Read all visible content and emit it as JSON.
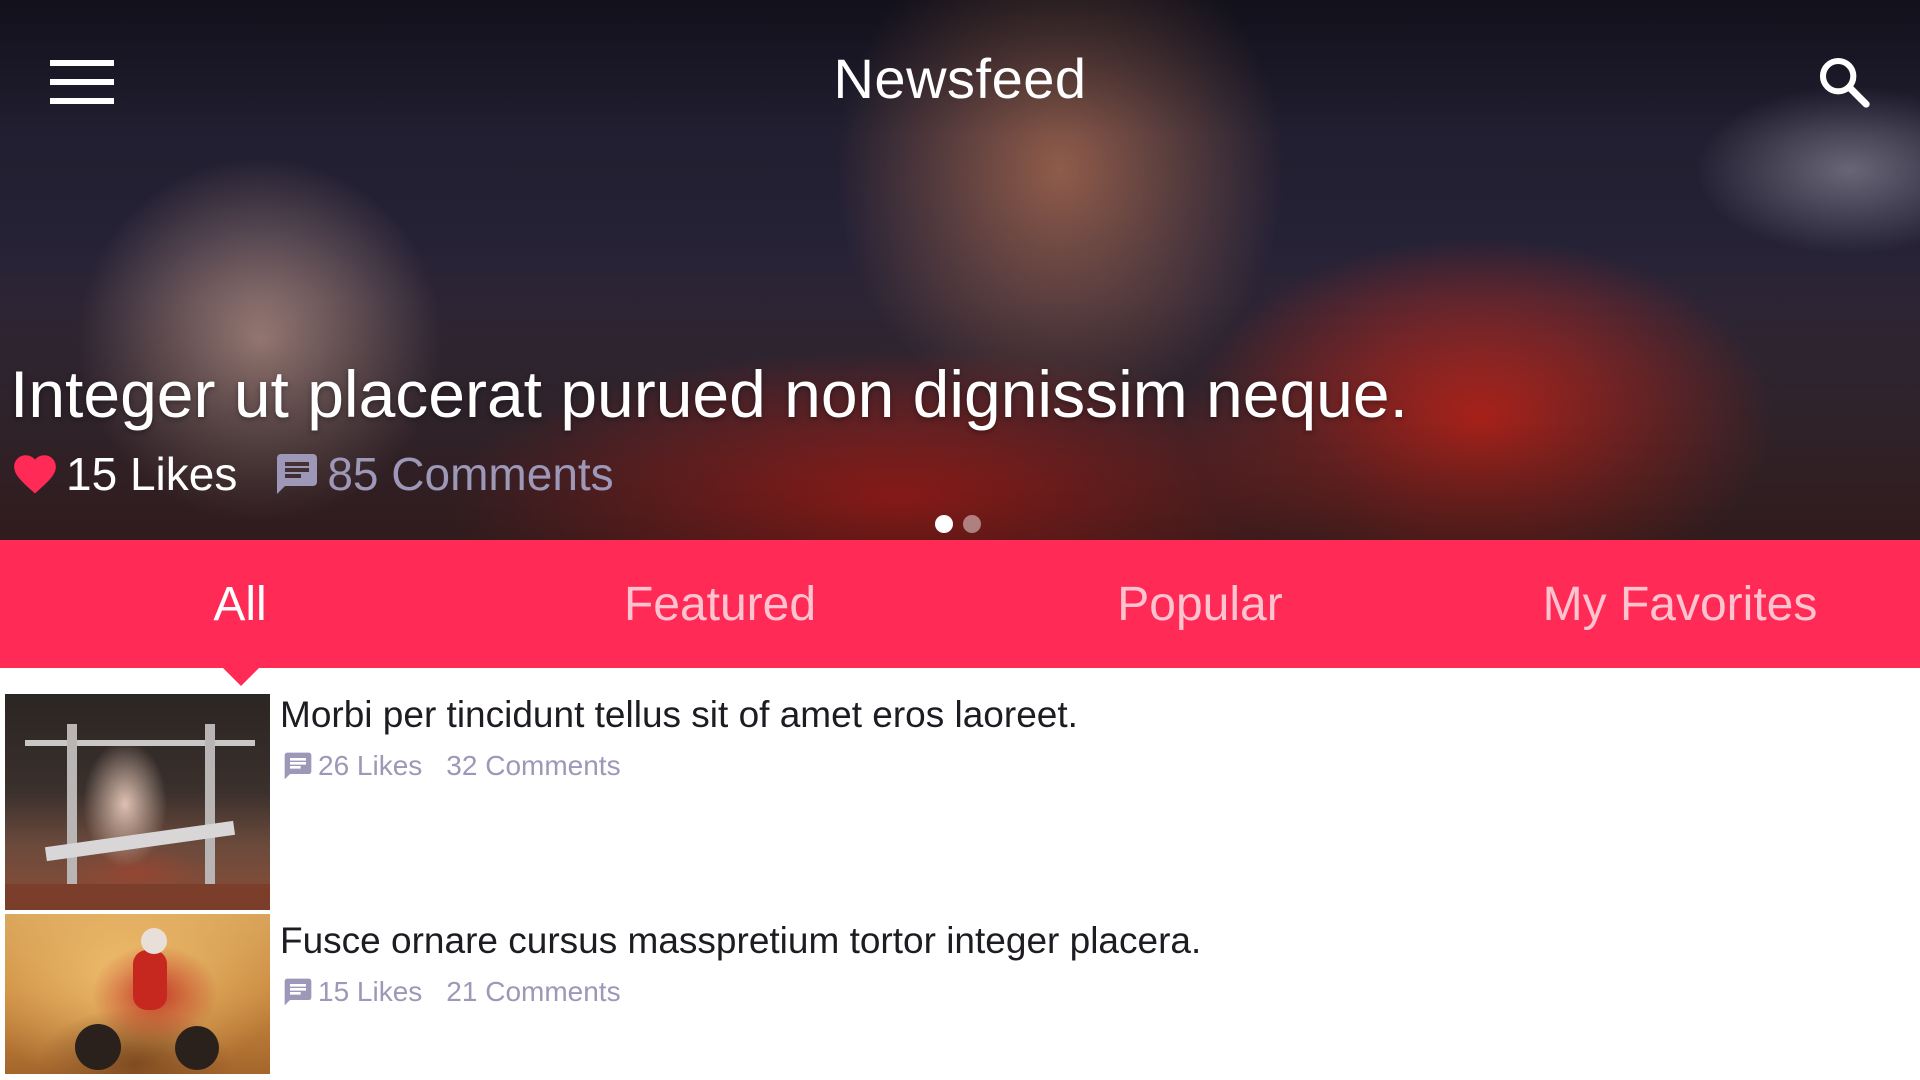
{
  "header": {
    "title": "Newsfeed",
    "menu_icon": "menu-icon",
    "search_icon": "search-icon"
  },
  "hero": {
    "headline": "Integer ut placerat purued non dignissim neque.",
    "likes": "15 Likes",
    "comments": "85 Comments",
    "likes_icon": "heart-icon",
    "comments_icon": "comment-icon",
    "slides_count": 2,
    "active_slide": 1
  },
  "tabs": [
    {
      "label": "All",
      "active": true
    },
    {
      "label": "Featured",
      "active": false
    },
    {
      "label": "Popular",
      "active": false
    },
    {
      "label": "My Favorites",
      "active": false
    }
  ],
  "feed": [
    {
      "title": "Morbi per tincidunt tellus sit of amet eros laoreet.",
      "likes": "26 Likes",
      "comments": "32 Comments",
      "icon": "comment-icon"
    },
    {
      "title": "Fusce ornare cursus masspretium tortor integer placera.",
      "likes": "15 Likes",
      "comments": "21 Comments",
      "icon": "comment-icon"
    }
  ],
  "colors": {
    "accent": "#ff2a55",
    "meta_text": "#9d98b8",
    "heart": "#ff2a55",
    "title_text": "#1e1b22"
  }
}
